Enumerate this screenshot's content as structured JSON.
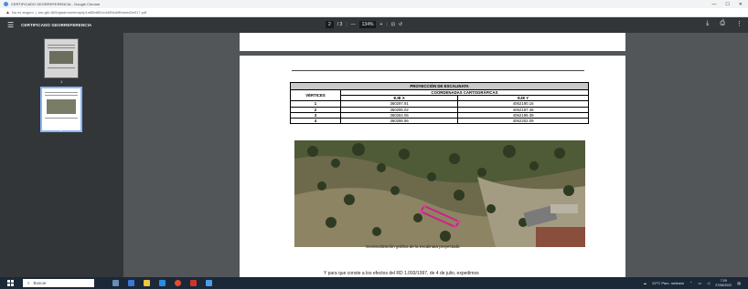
{
  "window": {
    "title": "CERTIFICADO GEORREFERENCIA - Google Chrome",
    "minimize": "—",
    "maximize": "☐",
    "close": "✕"
  },
  "address": {
    "security": "No es seguro",
    "url": "ww-gtb-805/gtadmon/temp/tp1e88b8f51e4455ed/ffbeeed0e017.pdf"
  },
  "pdf_toolbar": {
    "menu_icon": "menu-icon",
    "doc_title": "CERTIFICADO GEORREFERENCIA",
    "page_current": "2",
    "page_total": "/ 3",
    "zoom_out": "—",
    "zoom": "134%",
    "zoom_in": "+",
    "download_icon": "download-icon",
    "print_icon": "print-icon",
    "more_icon": "more-icon"
  },
  "thumbnails": [
    {
      "number": "1"
    },
    {
      "number": "2"
    }
  ],
  "document": {
    "table_title": "PROYECCIÓN DE ESCALINATA",
    "col_vertices": "VÉRTICES",
    "col_coords": "COORDENADAS CARTOGRÁFICAS",
    "col_x": "EJE X",
    "col_y": "EJE Y",
    "rows": [
      {
        "v": "1",
        "x": "360297.91",
        "y": "4062190.16"
      },
      {
        "v": "2",
        "x": "360295.02",
        "y": "4062187.48"
      },
      {
        "v": "3",
        "x": "360284.05",
        "y": "4062199.39"
      },
      {
        "v": "4",
        "x": "360286.96",
        "y": "4062202.09"
      }
    ],
    "caption": "Geolocalización gráfica de la escalinata proyectada",
    "bottom_text": "Y para que conste a los efectos del RD 1.093/1997, de 4 de julio, expedimos"
  },
  "taskbar": {
    "search_placeholder": "Buscar",
    "weather": "22°C Parc. nublado",
    "time": "7:29",
    "date": "27/06/2022"
  },
  "colors": {
    "toolbar": "#323639",
    "viewer_bg": "#525659",
    "selected_thumb": "#8ab4f8",
    "polygon": "#d01f8c"
  }
}
